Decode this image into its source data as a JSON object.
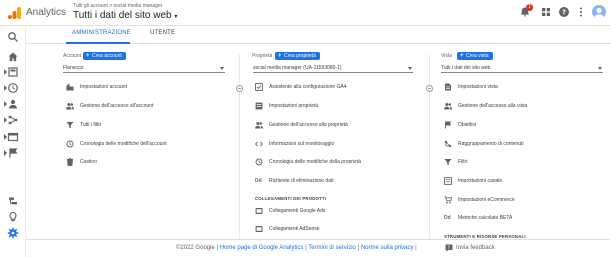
{
  "app": {
    "name": "Analytics",
    "breadcrumb": "Tutti gli account > social media manager",
    "property_title": "Tutti i dati del sito web",
    "notification_count": "1"
  },
  "tabs": {
    "admin": "AMMINISTRAZIONE",
    "user": "UTENTE"
  },
  "account": {
    "label": "Account",
    "create": "Crea account",
    "selected": "Flanecco",
    "items": [
      "Impostazioni account",
      "Gestione dell'accesso all'account",
      "Tutti i filtri",
      "Cronologia delle modifiche dell'account",
      "Cestino"
    ]
  },
  "property": {
    "label": "Proprietà",
    "create": "Crea proprietà",
    "selected": "social media manager (UA-11593080-1)",
    "items": [
      "Assistente alla configurazione GA4",
      "Impostazioni proprietà",
      "Gestione dell'accesso alla proprietà",
      "Informazioni sul monitoraggio",
      "Cronologia delle modifiche della proprietà",
      "Richieste di eliminazione dati"
    ],
    "section": "COLLEGAMENTI DEI PRODOTTI",
    "links": [
      "Collegamenti Google Ads",
      "Collegamenti AdSense"
    ],
    "dd_badge": "Dd"
  },
  "view": {
    "label": "Vista",
    "create": "Crea vista",
    "selected": "Tutti i dati del sito web",
    "items": [
      "Impostazioni vista",
      "Gestione dell'accesso alla vista",
      "Obiettivi",
      "Raggruppamento di contenuti",
      "Filtri",
      "Impostazioni canale",
      "Impostazioni eCommerce",
      "Metriche calcolate BETA"
    ],
    "section": "STRUMENTI E RISORSE PERSONALI",
    "dd_badge": "Dd"
  },
  "footer": {
    "copyright": "©2022 Google",
    "sep": " | ",
    "links": [
      "Home page di Google Analytics",
      "Termini di servizio",
      "Norme sulla privacy"
    ],
    "feedback": "Invia feedback"
  },
  "colors": {
    "accent": "#1a73e8",
    "logo_orange": "#f9ab00",
    "logo_dark": "#e37400",
    "badge": "#d93025"
  }
}
